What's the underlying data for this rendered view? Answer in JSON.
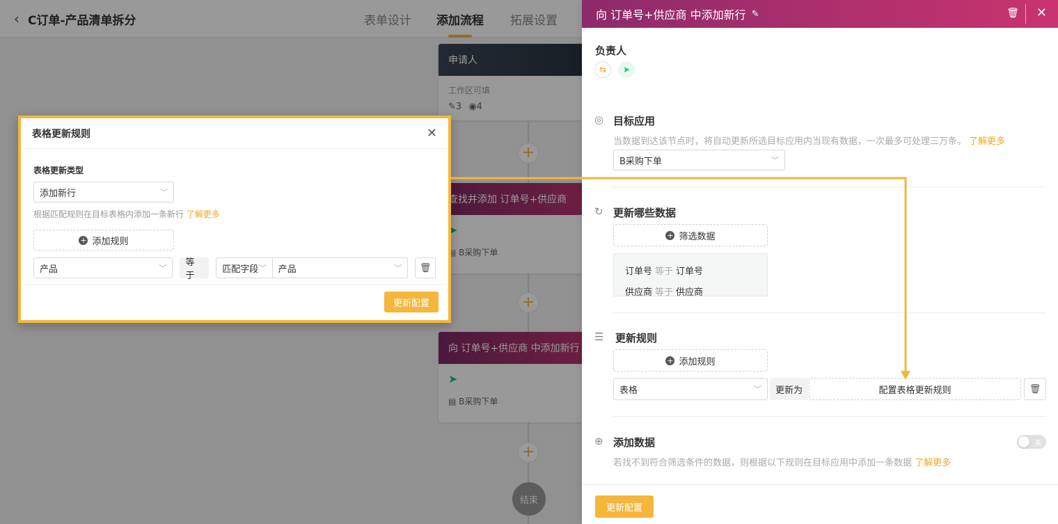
{
  "topbar": {
    "title": "C订单-产品清单拆分",
    "tabs": [
      {
        "label": "表单设计",
        "active": false
      },
      {
        "label": "添加流程",
        "active": true
      },
      {
        "label": "拓展设置",
        "active": false
      }
    ]
  },
  "flow": {
    "applicant": {
      "title": "申请人",
      "sub": "工作区可填",
      "edit_count": "3",
      "view_count": "4"
    },
    "find_node": {
      "title": "查找并添加 订单号+供应商",
      "app": "B采购下单"
    },
    "add_node": {
      "title": "向 订单号+供应商 中添加新行",
      "app": "B采购下单"
    },
    "end_label": "结束"
  },
  "modal": {
    "title": "表格更新规则",
    "type_label": "表格更新类型",
    "type_value": "添加新行",
    "hint": "根据匹配规则在目标表格内添加一条新行",
    "learn_more": "了解更多",
    "add_rule": "添加规则",
    "rule": {
      "field": "产品",
      "op": "等于",
      "match": "匹配字段",
      "value": "产品"
    },
    "submit": "更新配置"
  },
  "panel": {
    "title": "向 订单号+供应商 中添加新行",
    "owner_label": "负责人",
    "target": {
      "title": "目标应用",
      "hint": "当数据到达该节点时，将自动更新所选目标应用内当现有数据，一次最多可处理三万条。",
      "learn_more": "了解更多",
      "value": "B采购下单"
    },
    "update_which": {
      "title": "更新哪些数据",
      "filter_button": "筛选数据",
      "conditions": [
        {
          "field": "订单号",
          "op": "等于",
          "value": "订单号"
        },
        {
          "field": "供应商",
          "op": "等于",
          "value": "供应商"
        }
      ]
    },
    "rules": {
      "title": "更新规则",
      "add_rule": "添加规则",
      "field": "表格",
      "op": "更新为",
      "config_button": "配置表格更新规则"
    },
    "add_data": {
      "title": "添加数据",
      "hint": "若找不到符合筛选条件的数据，则根据以下规则在目标应用中添加一条数据",
      "learn_more": "了解更多",
      "toggle_label": "关"
    },
    "submit": "更新配置"
  },
  "colors": {
    "accent": "#f4b63b",
    "header_pink": "#c9346f",
    "success_green": "#1dbf73"
  }
}
